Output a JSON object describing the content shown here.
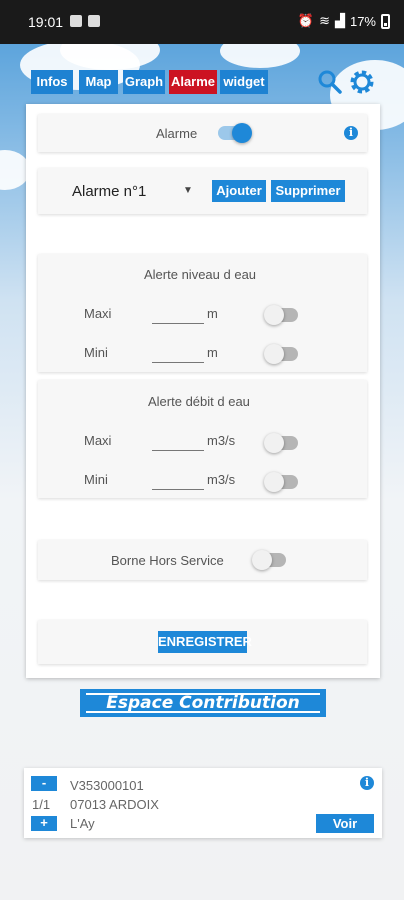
{
  "status_bar": {
    "time": "19:01",
    "battery": "17%"
  },
  "tabs": [
    {
      "label": "Infos"
    },
    {
      "label": "Map"
    },
    {
      "label": "Graph"
    },
    {
      "label": "Alarme",
      "active": true
    },
    {
      "label": "widget"
    }
  ],
  "top_icons": [
    "search-icon",
    "gear-icon"
  ],
  "alarm": {
    "toggle_label": "Alarme",
    "toggle_on": true,
    "selected": "Alarme n°1",
    "add_label": "Ajouter",
    "delete_label": "Supprimer"
  },
  "niveau": {
    "title": "Alerte niveau d eau",
    "max_label": "Maxi",
    "max_value": "",
    "max_unit": "m",
    "max_on": false,
    "min_label": "Mini",
    "min_value": "",
    "min_unit": "m",
    "min_on": false
  },
  "debit": {
    "title": "Alerte débit d eau",
    "max_label": "Maxi",
    "max_value": "",
    "max_unit": "m3/s",
    "max_on": false,
    "min_label": "Mini",
    "min_value": "",
    "min_unit": "m3/s",
    "min_on": false
  },
  "borne": {
    "label": "Borne Hors Service",
    "on": false
  },
  "save_label": "ENREGISTRER",
  "espace_label": "Espace Contribution",
  "item": {
    "minus": "-",
    "plus": "+",
    "counter": "1/1",
    "code": "V353000101",
    "commune": "07013 ARDOIX",
    "river": "L'Ay",
    "view_label": "Voir"
  },
  "colors": {
    "accent": "#1e88d8",
    "active_tab": "#cc1322"
  }
}
